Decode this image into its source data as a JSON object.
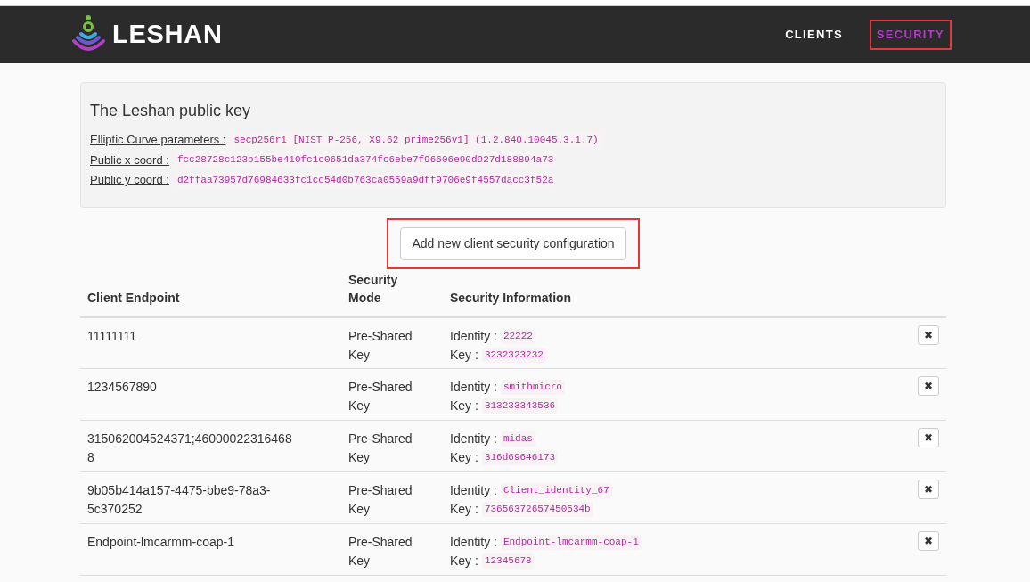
{
  "navbar": {
    "brand": "LESHAN",
    "links": [
      {
        "label": "CLIENTS",
        "selected": false,
        "highlighted": false
      },
      {
        "label": "SECURITY",
        "selected": true,
        "highlighted": true
      }
    ]
  },
  "public_key": {
    "title": "The Leshan public key",
    "fields": [
      {
        "label": "Elliptic Curve parameters :",
        "value": "secp256r1 [NIST P-256, X9.62 prime256v1] (1.2.840.10045.3.1.7)"
      },
      {
        "label": "Public x coord :",
        "value": "fcc28728c123b155be410fc1c0651da374fc6ebe7f96606e90d927d188894a73"
      },
      {
        "label": "Public y coord :",
        "value": "d2ffaa73957d76984633fc1cc54d0b763ca0559a9dff9706e9f4557dacc3f52a"
      }
    ]
  },
  "add_button": {
    "label": "Add new client security configuration",
    "highlighted": true
  },
  "table": {
    "columns": [
      "Client Endpoint",
      "Security Mode",
      "Security Information"
    ],
    "rows": [
      {
        "endpoint": "11111111",
        "mode": "Pre-Shared Key",
        "identity_label": "Identity :",
        "identity": "22222",
        "key_label": "Key :",
        "key": "3232323232",
        "delete": "✖"
      },
      {
        "endpoint": "1234567890",
        "mode": "Pre-Shared Key",
        "identity_label": "Identity :",
        "identity": "smithmicro",
        "key_label": "Key :",
        "key": "313233343536",
        "delete": "✖"
      },
      {
        "endpoint": "315062004524371;460000223164688",
        "mode": "Pre-Shared Key",
        "identity_label": "Identity :",
        "identity": "midas",
        "key_label": "Key :",
        "key": "316d69646173",
        "delete": "✖"
      },
      {
        "endpoint": "9b05b414a157-4475-bbe9-78a3-5c370252",
        "mode": "Pre-Shared Key",
        "identity_label": "Identity :",
        "identity": "Client_identity_67",
        "key_label": "Key :",
        "key": "73656372657450534b",
        "delete": "✖"
      },
      {
        "endpoint": "Endpoint-lmcarmm-coap-1",
        "mode": "Pre-Shared Key",
        "identity_label": "Identity :",
        "identity": "Endpoint-lmcarmm-coap-1",
        "key_label": "Key :",
        "key": "12345678",
        "delete": "✖"
      }
    ]
  }
}
